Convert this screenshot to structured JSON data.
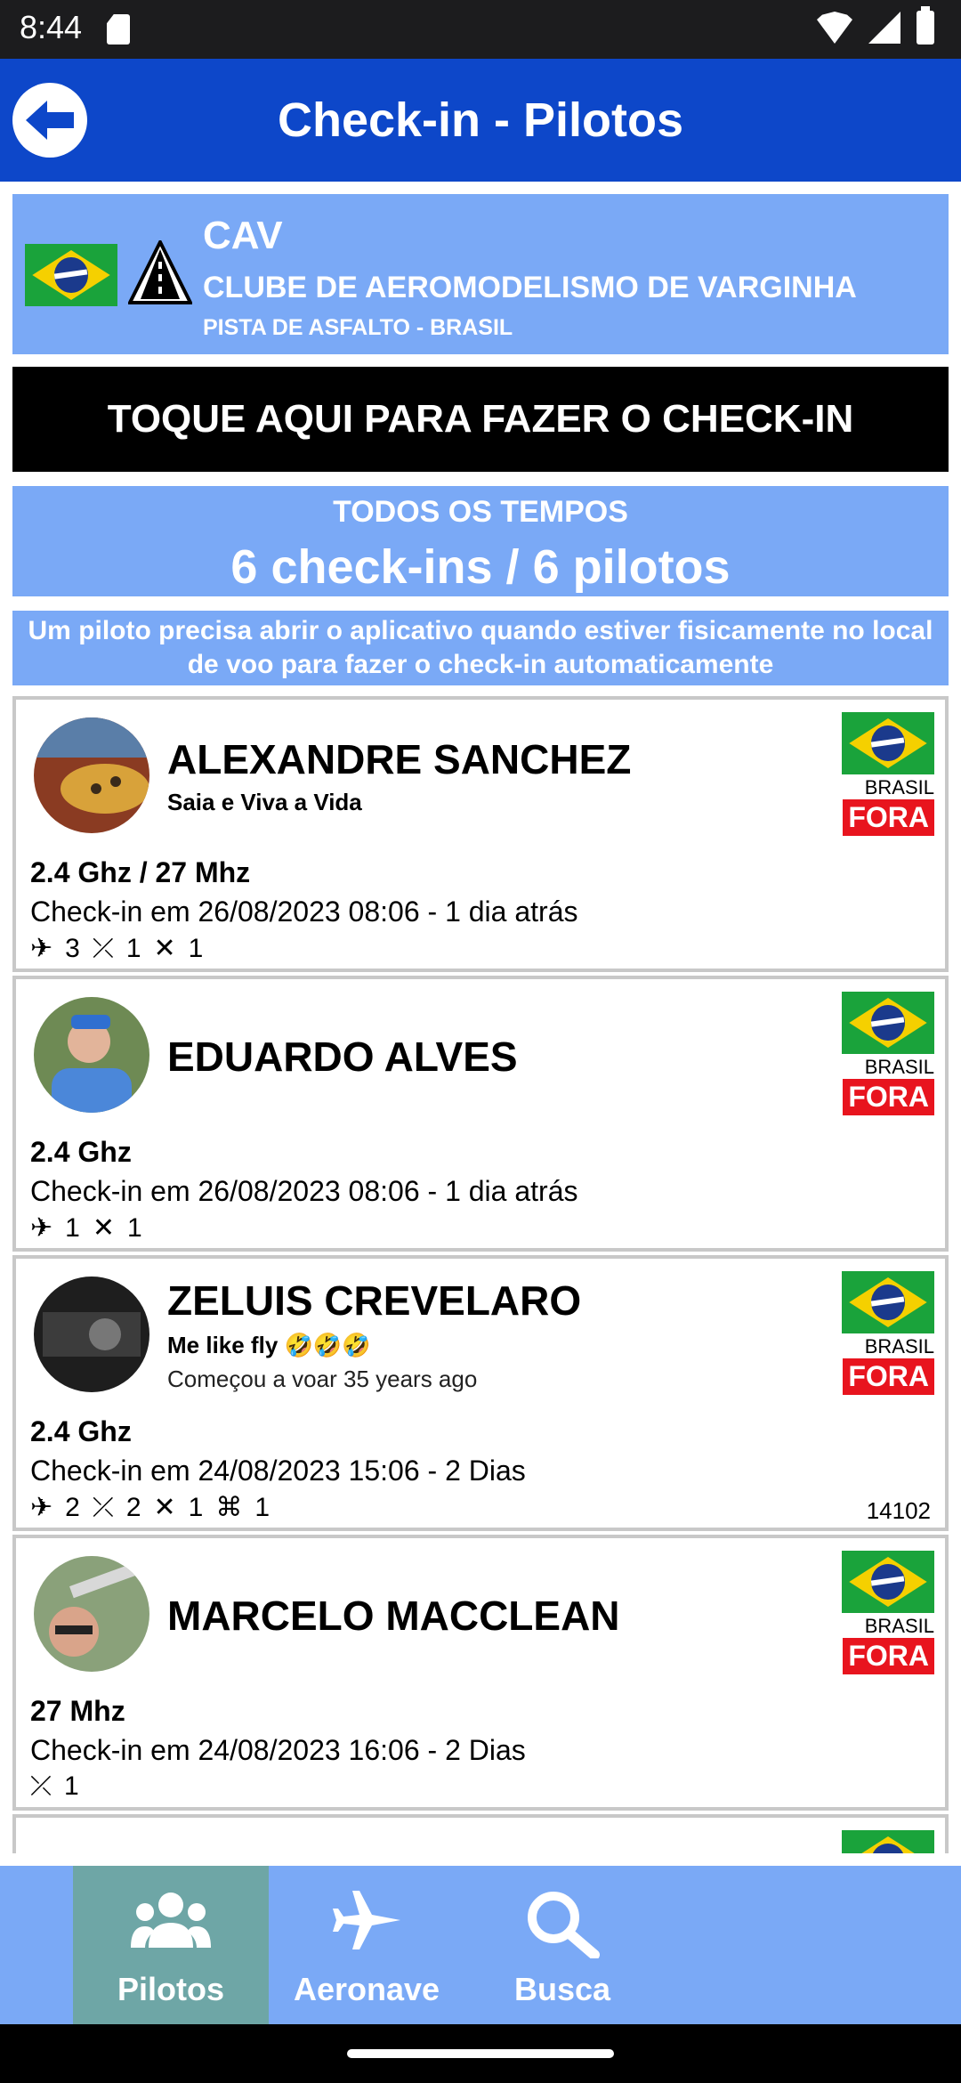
{
  "status_bar": {
    "time": "8:44"
  },
  "app_bar": {
    "title": "Check-in - Pilotos"
  },
  "club": {
    "code": "CAV",
    "name": "CLUBE DE AEROMODELISMO DE VARGINHA",
    "subtitle": "PISTA DE ASFALTO - BRASIL"
  },
  "checkin_button": "TOQUE AQUI PARA FAZER O CHECK-IN",
  "stats": {
    "period": "TODOS OS TEMPOS",
    "summary": "6 check-ins / 6 pilotos"
  },
  "notice": "Um piloto precisa abrir o aplicativo quando estiver fisicamente no local de voo para fazer o check-in automaticamente",
  "pilots": [
    {
      "name": "ALEXANDRE SANCHEZ",
      "motto": "Saia e Viva a Vida",
      "since": "",
      "country": "BRASIL",
      "status": "FORA",
      "frequency": "2.4 Ghz / 27 Mhz",
      "checkin": "Check-in em 26/08/2023 08:06 - 1 dia atrás",
      "aircraft": {
        "airplane": "3",
        "glider": "1",
        "heli": "1",
        "drone": ""
      },
      "id": ""
    },
    {
      "name": "EDUARDO ALVES",
      "motto": "",
      "since": "",
      "country": "BRASIL",
      "status": "FORA",
      "frequency": "2.4 Ghz",
      "checkin": "Check-in em 26/08/2023 08:06 - 1 dia atrás",
      "aircraft": {
        "airplane": "1",
        "glider": "",
        "heli": "1",
        "drone": ""
      },
      "id": ""
    },
    {
      "name": "ZELUIS CREVELARO",
      "motto": "Me like fly 🤣🤣🤣",
      "since": "Começou a voar 35 years ago",
      "country": "BRASIL",
      "status": "FORA",
      "frequency": "2.4 Ghz",
      "checkin": "Check-in em 24/08/2023 15:06 - 2 Dias",
      "aircraft": {
        "airplane": "2",
        "glider": "2",
        "heli": "1",
        "drone": "1"
      },
      "id": "14102"
    },
    {
      "name": "MARCELO MACCLEAN",
      "motto": "",
      "since": "",
      "country": "BRASIL",
      "status": "FORA",
      "frequency": "27 Mhz",
      "checkin": "Check-in em 24/08/2023 16:06 - 2 Dias",
      "aircraft": {
        "airplane": "",
        "glider": "1",
        "heli": "",
        "drone": ""
      },
      "id": ""
    }
  ],
  "bottom_nav": [
    {
      "label": "Pilotos",
      "icon": "group-icon",
      "active": true
    },
    {
      "label": "Aeronave",
      "icon": "airplane-icon",
      "active": false
    },
    {
      "label": "Busca",
      "icon": "search-icon",
      "active": false
    }
  ],
  "colors": {
    "app_bar": "#0d47c9",
    "panel": "#7aa9f6",
    "status_out": "#e8141e",
    "nav_active": "#6ea6a6"
  }
}
